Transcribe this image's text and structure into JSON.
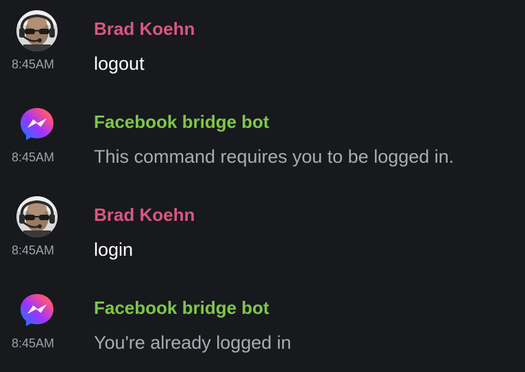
{
  "timeline": {
    "messages": [
      {
        "sender": "Brad Koehn",
        "time": "8:45AM",
        "text": "logout",
        "kind": "user",
        "avatar_icon": "user-photo-avatar"
      },
      {
        "sender": "Facebook bridge bot",
        "time": "8:45AM",
        "text": "This command requires you to be logged in.",
        "kind": "notice",
        "avatar_icon": "messenger-logo-icon"
      },
      {
        "sender": "Brad Koehn",
        "time": "8:45AM",
        "text": "login",
        "kind": "user",
        "avatar_icon": "user-photo-avatar"
      },
      {
        "sender": "Facebook bridge bot",
        "time": "8:45AM",
        "text": "You're already logged in",
        "kind": "notice",
        "avatar_icon": "messenger-logo-icon"
      }
    ]
  },
  "colors": {
    "background": "#17191d",
    "user_sender": "#d8577e",
    "bot_sender": "#7fc64a",
    "timestamp": "#9ea2a8",
    "user_text": "#ffffff",
    "notice_text": "#a9acb1"
  }
}
